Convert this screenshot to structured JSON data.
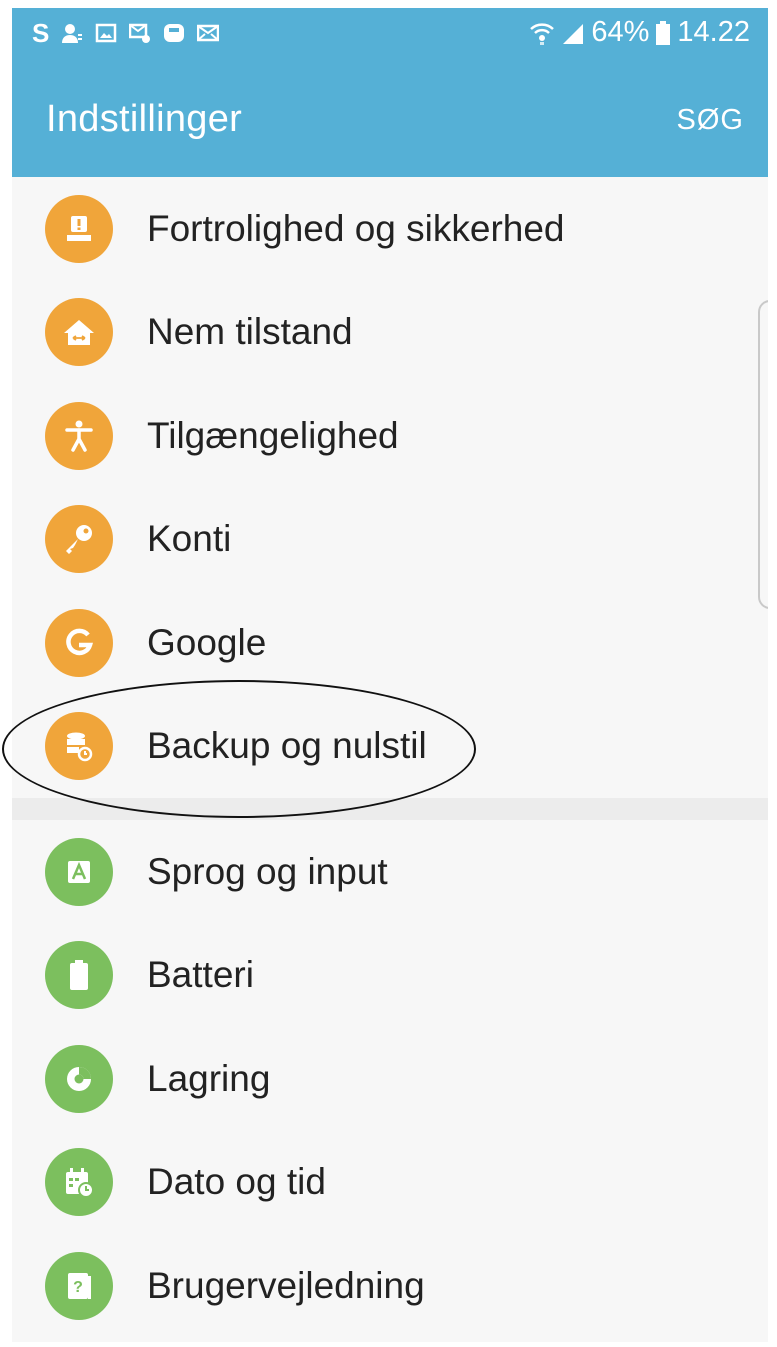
{
  "status_bar": {
    "left_glyph": "S",
    "left_icons": [
      "person-icon",
      "image-icon",
      "message-settings-icon",
      "galaxy-icon",
      "mail-icon"
    ],
    "battery_percent": "64%",
    "time": "14.22",
    "right_icons": [
      "wifi-icon",
      "signal-icon",
      "battery-icon"
    ]
  },
  "appbar": {
    "title": "Indstillinger",
    "search_label": "SØG",
    "color": "#55b0d6"
  },
  "group1_color": "#f0a53a",
  "group2_color": "#7cbf5e",
  "items": [
    {
      "label": "Fortrolighed og sikkerhed",
      "icon": "privacy-icon"
    },
    {
      "label": "Nem tilstand",
      "icon": "easy-mode-icon"
    },
    {
      "label": "Tilgængelighed",
      "icon": "accessibility-icon"
    },
    {
      "label": "Konti",
      "icon": "key-icon"
    },
    {
      "label": "Google",
      "icon": "google-icon"
    },
    {
      "label": "Backup og nulstil",
      "icon": "backup-icon"
    },
    {
      "label": "Sprog og input",
      "icon": "language-icon"
    },
    {
      "label": "Batteri",
      "icon": "battery-settings-icon"
    },
    {
      "label": "Lagring",
      "icon": "storage-icon"
    },
    {
      "label": "Dato og tid",
      "icon": "calendar-icon"
    },
    {
      "label": "Brugervejledning",
      "icon": "user-manual-icon"
    }
  ]
}
